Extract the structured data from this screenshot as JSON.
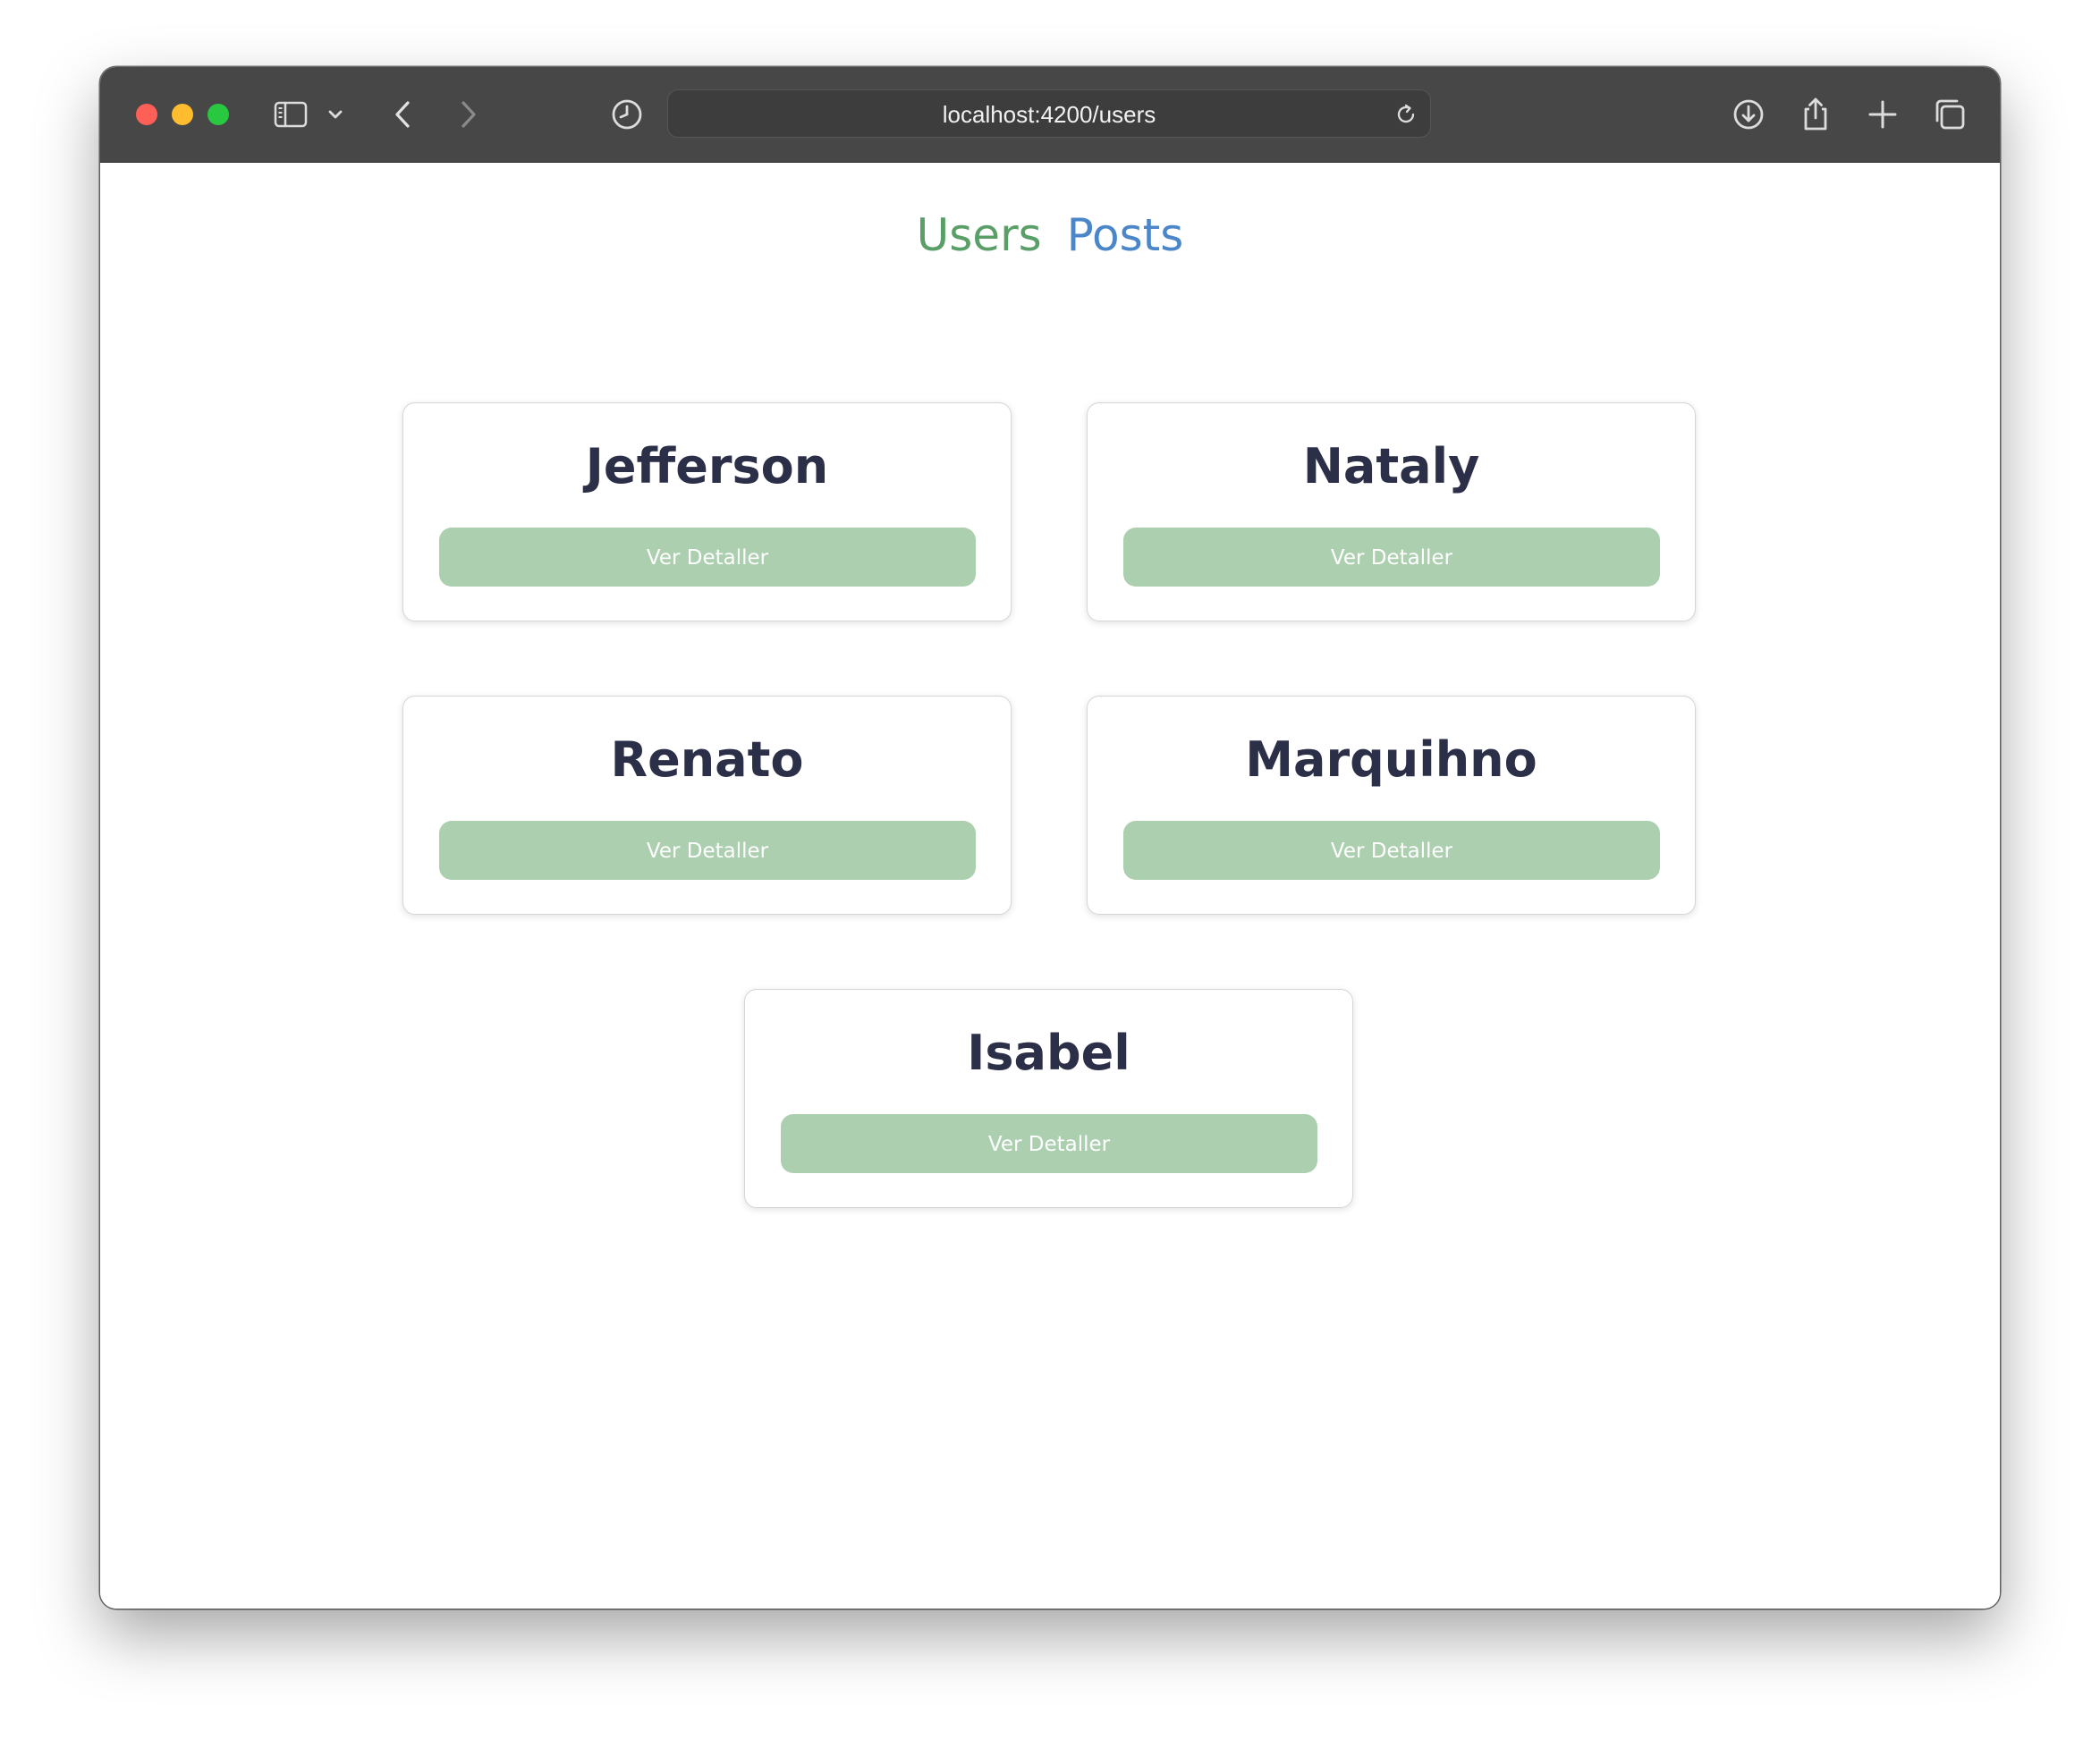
{
  "browser": {
    "url": "localhost:4200/users",
    "icons": {
      "sidebar": "sidebar-icon",
      "chevron": "chevron-down-icon",
      "back": "back-arrow-icon",
      "forward": "forward-arrow-icon",
      "history": "clock-icon",
      "reload": "reload-icon",
      "download": "download-icon",
      "share": "share-icon",
      "new_tab": "plus-icon",
      "tabs": "tab-overview-icon"
    }
  },
  "nav": {
    "users_label": "Users",
    "posts_label": "Posts",
    "users_color": "#5a9e68",
    "posts_color": "#4b86c9"
  },
  "users": [
    {
      "name": "Jefferson",
      "button_label": "Ver Detaller"
    },
    {
      "name": "Nataly",
      "button_label": "Ver Detaller"
    },
    {
      "name": "Renato",
      "button_label": "Ver Detaller"
    },
    {
      "name": "Marquihno",
      "button_label": "Ver Detaller"
    },
    {
      "name": "Isabel",
      "button_label": "Ver Detaller"
    }
  ],
  "colors": {
    "button_bg": "#abcfaf",
    "name_text": "#2c2f48",
    "toolbar_bg": "#474747"
  }
}
